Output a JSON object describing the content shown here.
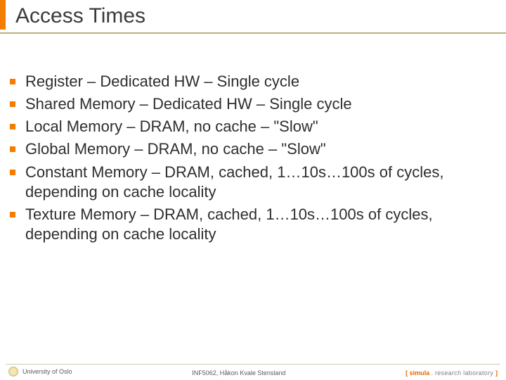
{
  "header": {
    "title": "Access Times"
  },
  "bullets": [
    "Register – Dedicated HW – Single cycle",
    "Shared Memory – Dedicated HW – Single cycle",
    "Local Memory – DRAM, no cache – \"Slow\"",
    "Global Memory – DRAM, no cache – \"Slow\"",
    "Constant Memory – DRAM, cached, 1…10s…100s of cycles, depending on cache locality",
    "Texture Memory – DRAM, cached, 1…10s…100s of cycles, depending on cache locality"
  ],
  "footer": {
    "left": "University of Oslo",
    "mid": "INF5062, Håkon Kvale Stensland",
    "brand": {
      "open": "[",
      "main": " simula ",
      "dot": ".",
      "rest": " research laboratory ",
      "close": "]"
    }
  }
}
